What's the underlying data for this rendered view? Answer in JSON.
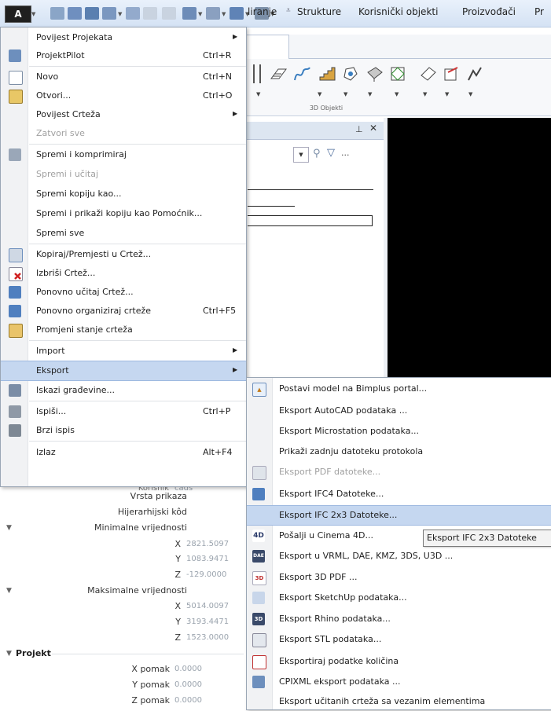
{
  "app_button": {
    "label": "A"
  },
  "quick_access": {
    "icons": [
      "project-icon",
      "layout-icon",
      "save-icon",
      "edit-icon",
      "comment-icon",
      "undo-icon",
      "redo-icon",
      "frame-icon",
      "settings-icon",
      "layers-icon",
      "tools-icon",
      "customize-icon"
    ]
  },
  "ribbon": {
    "tabs": [
      "liranje",
      "Strukture",
      "Korisnički objekti",
      "Proizvođači",
      "Pr"
    ],
    "active_tab": "liranje",
    "group_label": "3D Objekti"
  },
  "panel": {
    "pin": "ᚕ",
    "close": "✕",
    "more": "..."
  },
  "main_menu": {
    "items": [
      {
        "label": "Povijest Projekata",
        "shortcut": "",
        "submenu": true,
        "enabled": true,
        "icon": ""
      },
      {
        "label": "ProjektPilot",
        "shortcut": "Ctrl+R",
        "submenu": false,
        "enabled": true,
        "icon": "project-pilot-icon"
      },
      {
        "label": "Novo",
        "shortcut": "Ctrl+N",
        "submenu": false,
        "enabled": true,
        "icon": "new-file-icon"
      },
      {
        "label": "Otvori...",
        "shortcut": "Ctrl+O",
        "submenu": false,
        "enabled": true,
        "icon": "open-folder-icon"
      },
      {
        "label": "Povijest Crteža",
        "shortcut": "",
        "submenu": true,
        "enabled": true,
        "icon": ""
      },
      {
        "label": "Zatvori sve",
        "shortcut": "",
        "submenu": false,
        "enabled": false,
        "icon": ""
      },
      {
        "label": "Spremi i komprimiraj",
        "shortcut": "",
        "submenu": false,
        "enabled": true,
        "icon": "compress-icon"
      },
      {
        "label": "Spremi i učitaj",
        "shortcut": "",
        "submenu": false,
        "enabled": false,
        "icon": ""
      },
      {
        "label": "Spremi kopiju kao...",
        "shortcut": "",
        "submenu": false,
        "enabled": true,
        "icon": ""
      },
      {
        "label": "Spremi i prikaži kopiju kao Pomoćnik...",
        "shortcut": "",
        "submenu": false,
        "enabled": true,
        "icon": ""
      },
      {
        "label": "Spremi sve",
        "shortcut": "",
        "submenu": false,
        "enabled": true,
        "icon": ""
      },
      {
        "label": "Kopiraj/Premjesti u Crtež...",
        "shortcut": "",
        "submenu": false,
        "enabled": true,
        "icon": "copy-move-icon"
      },
      {
        "label": "Izbriši Crtež...",
        "shortcut": "",
        "submenu": false,
        "enabled": true,
        "icon": "delete-drawing-icon"
      },
      {
        "label": "Ponovno učitaj Crtež...",
        "shortcut": "",
        "submenu": false,
        "enabled": true,
        "icon": "reload-icon"
      },
      {
        "label": "Ponovno organiziraj crteže",
        "shortcut": "Ctrl+F5",
        "submenu": false,
        "enabled": true,
        "icon": "reorganize-icon"
      },
      {
        "label": "Promjeni stanje crteža",
        "shortcut": "",
        "submenu": false,
        "enabled": true,
        "icon": "change-state-icon"
      },
      {
        "label": "Import",
        "shortcut": "",
        "submenu": true,
        "enabled": true,
        "icon": ""
      },
      {
        "label": "Eksport",
        "shortcut": "",
        "submenu": true,
        "enabled": true,
        "icon": "",
        "highlighted": true
      },
      {
        "label": "Iskazi građevine...",
        "shortcut": "",
        "submenu": false,
        "enabled": true,
        "icon": "building-report-icon"
      },
      {
        "label": "Ispiši...",
        "shortcut": "Ctrl+P",
        "submenu": false,
        "enabled": true,
        "icon": "printer-icon"
      },
      {
        "label": "Brzi ispis",
        "shortcut": "",
        "submenu": false,
        "enabled": true,
        "icon": "quick-print-icon"
      },
      {
        "label": "Izlaz",
        "shortcut": "Alt+F4",
        "submenu": false,
        "enabled": true,
        "icon": ""
      }
    ]
  },
  "export_submenu": {
    "items": [
      {
        "label": "Postavi model na Bimplus portal...",
        "enabled": true,
        "icon": "bimplus-icon"
      },
      {
        "label": "Eksport AutoCAD podataka ...",
        "enabled": true,
        "icon": ""
      },
      {
        "label": "Eksport Microstation podataka...",
        "enabled": true,
        "icon": ""
      },
      {
        "label": "Prikaži zadnju datoteku protokola",
        "enabled": true,
        "icon": ""
      },
      {
        "label": "Eksport PDF datoteke...",
        "enabled": false,
        "icon": "pdf-icon"
      },
      {
        "label": "Eksport IFC4 Datoteke...",
        "enabled": true,
        "icon": "ifc4-icon"
      },
      {
        "label": "Eksport IFC 2x3 Datoteke...",
        "enabled": true,
        "icon": "",
        "highlighted": true
      },
      {
        "label": "Pošalji u Cinema 4D...",
        "enabled": true,
        "icon": "cinema4d-icon"
      },
      {
        "label": "Eksport u VRML, DAE, KMZ, 3DS, U3D ...",
        "enabled": true,
        "icon": "dae-icon"
      },
      {
        "label": "Eksport 3D PDF ...",
        "enabled": true,
        "icon": "3d-pdf-icon"
      },
      {
        "label": "Eksport SketchUp podataka...",
        "enabled": true,
        "icon": "sketchup-icon"
      },
      {
        "label": "Eksport Rhino podataka...",
        "enabled": true,
        "icon": "rhino-icon"
      },
      {
        "label": "Eksport STL podataka...",
        "enabled": true,
        "icon": "stl-icon"
      },
      {
        "label": "Eksportiraj podatke količina",
        "enabled": true,
        "icon": "quantities-icon"
      },
      {
        "label": "CPIXML eksport podataka ...",
        "enabled": true,
        "icon": "cpixml-icon"
      },
      {
        "label": "Eksport učitanih crteža sa vezanim elementima",
        "enabled": true,
        "icon": ""
      }
    ],
    "icon_texts": {
      "cinema4d": "4D",
      "dae": "DAE",
      "3d_pdf": "3D",
      "rhino": "3D"
    }
  },
  "tooltip": {
    "text": "Eksport IFC 2x3 Datoteke"
  },
  "properties": {
    "partial_label": "Korisnik",
    "partial_value": "cads",
    "vrsta_prikaza": "Vrsta prikaza",
    "hijerarhijski_kod": "Hijerarhijski kôd",
    "min_label": "Minimalne vrijednosti",
    "max_label": "Maksimalne vrijednosti",
    "min": {
      "x_label": "X",
      "x": "2821.5097",
      "y_label": "Y",
      "y": "1083.9471",
      "z_label": "Z",
      "z": "-129.0000"
    },
    "max": {
      "x_label": "X",
      "x": "5014.0097",
      "y_label": "Y",
      "y": "3193.4471",
      "z_label": "Z",
      "z": "1523.0000"
    },
    "projekt_label": "Projekt",
    "x_pomak_label": "X pomak",
    "x_pomak": "0.0000",
    "y_pomak_label": "Y pomak",
    "y_pomak": "0.0000",
    "z_pomak_label": "Z pomak",
    "z_pomak": "0.0000"
  },
  "colors": {
    "highlight": "#c5d7f0",
    "canvas": "#000000",
    "disabled_text": "#a0a0a0"
  }
}
